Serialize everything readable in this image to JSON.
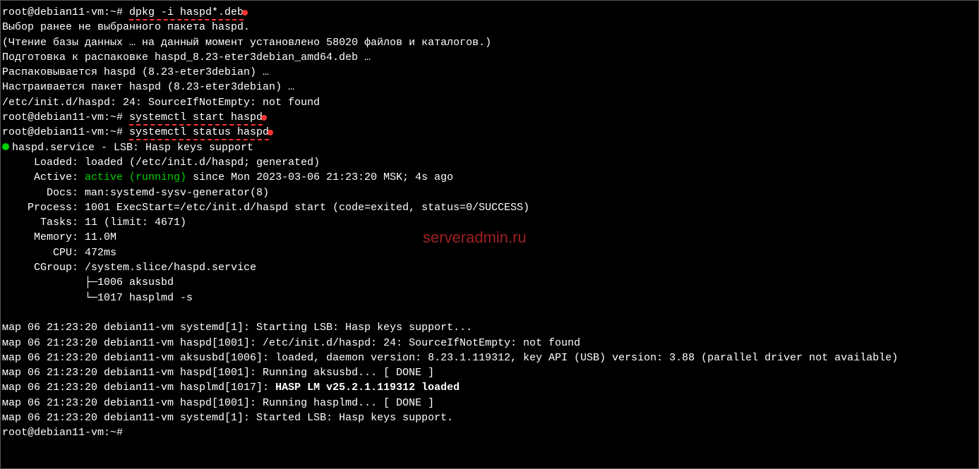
{
  "prompt1": "root@debian11-vm:~# ",
  "cmd1": "dpkg -i haspd*.deb",
  "line1": "Выбор ранее не выбранного пакета haspd.",
  "line2": "(Чтение базы данных … на данный момент установлено 58020 файлов и каталогов.)",
  "line3": "Подготовка к распаковке haspd_8.23-eter3debian_amd64.deb …",
  "line4": "Распаковывается haspd (8.23-eter3debian) …",
  "line5": "Настраивается пакет haspd (8.23-eter3debian) …",
  "line6": "/etc/init.d/haspd: 24: SourceIfNotEmpty: not found",
  "prompt2": "root@debian11-vm:~# ",
  "cmd2": "systemctl start haspd",
  "prompt3": "root@debian11-vm:~# ",
  "cmd3": "systemctl status haspd",
  "service_name": "haspd.service - LSB: Hasp keys support",
  "loaded_label": "     Loaded: ",
  "loaded_value": "loaded (/etc/init.d/haspd; generated)",
  "active_label": "     Active: ",
  "active_state": "active (running)",
  "active_since": " since Mon 2023-03-06 21:23:20 MSK; 4s ago",
  "docs_label": "       Docs: ",
  "docs_value": "man:systemd-sysv-generator(8)",
  "process_label": "    Process: ",
  "process_value": "1001 ExecStart=/etc/init.d/haspd start (code=exited, status=0/SUCCESS)",
  "tasks_label": "      Tasks: ",
  "tasks_value": "11 (limit: 4671)",
  "memory_label": "     Memory: ",
  "memory_value": "11.0M",
  "cpu_label": "        CPU: ",
  "cpu_value": "472ms",
  "cgroup_label": "     CGroup: ",
  "cgroup_value": "/system.slice/haspd.service",
  "tree1": "             ├─1006 aksusbd",
  "tree2": "             └─1017 hasplmd -s",
  "log1": "мар 06 21:23:20 debian11-vm systemd[1]: Starting LSB: Hasp keys support...",
  "log2": "мар 06 21:23:20 debian11-vm haspd[1001]: /etc/init.d/haspd: 24: SourceIfNotEmpty: not found",
  "log3": "мар 06 21:23:20 debian11-vm aksusbd[1006]: loaded, daemon version: 8.23.1.119312, key API (USB) version: 3.88 (parallel driver not available)",
  "log4": "мар 06 21:23:20 debian11-vm haspd[1001]: Running aksusbd... [ DONE ]",
  "log5_prefix": "мар 06 21:23:20 debian11-vm hasplmd[1017]: ",
  "log5_bold": "HASP LM v25.2.1.119312 loaded",
  "log6": "мар 06 21:23:20 debian11-vm haspd[1001]: Running hasplmd... [ DONE ]",
  "log7": "мар 06 21:23:20 debian11-vm systemd[1]: Started LSB: Hasp keys support.",
  "prompt4": "root@debian11-vm:~#",
  "watermark": "serveradmin.ru"
}
